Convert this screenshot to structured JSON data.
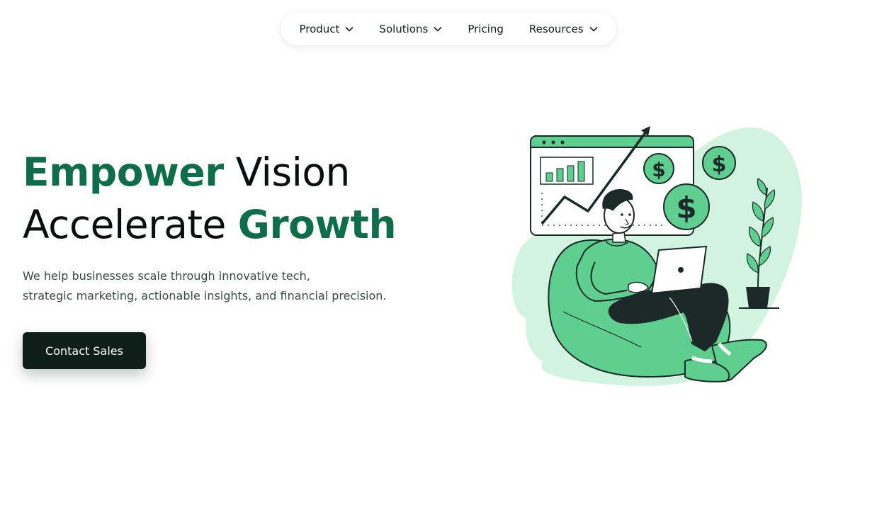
{
  "nav": {
    "items": [
      {
        "label": "Product",
        "has_dropdown": true
      },
      {
        "label": "Solutions",
        "has_dropdown": true
      },
      {
        "label": "Pricing",
        "has_dropdown": false
      },
      {
        "label": "Resources",
        "has_dropdown": true
      }
    ]
  },
  "hero": {
    "headline_line1_green": "Empower",
    "headline_line1_dark": "Vision",
    "headline_line2_dark": "Accelerate",
    "headline_line2_green": "Growth",
    "subtext_line1": "We help businesses scale through innovative tech,",
    "subtext_line2": "strategic marketing, actionable insights, and financial precision.",
    "cta_label": "Contact Sales"
  },
  "illustration": {
    "currency_symbol": "$"
  },
  "colors": {
    "brand_green": "#0f6e4a",
    "illus_green": "#5ecf8f",
    "illus_light": "#d3f3e1",
    "dark": "#0e1f1a"
  }
}
